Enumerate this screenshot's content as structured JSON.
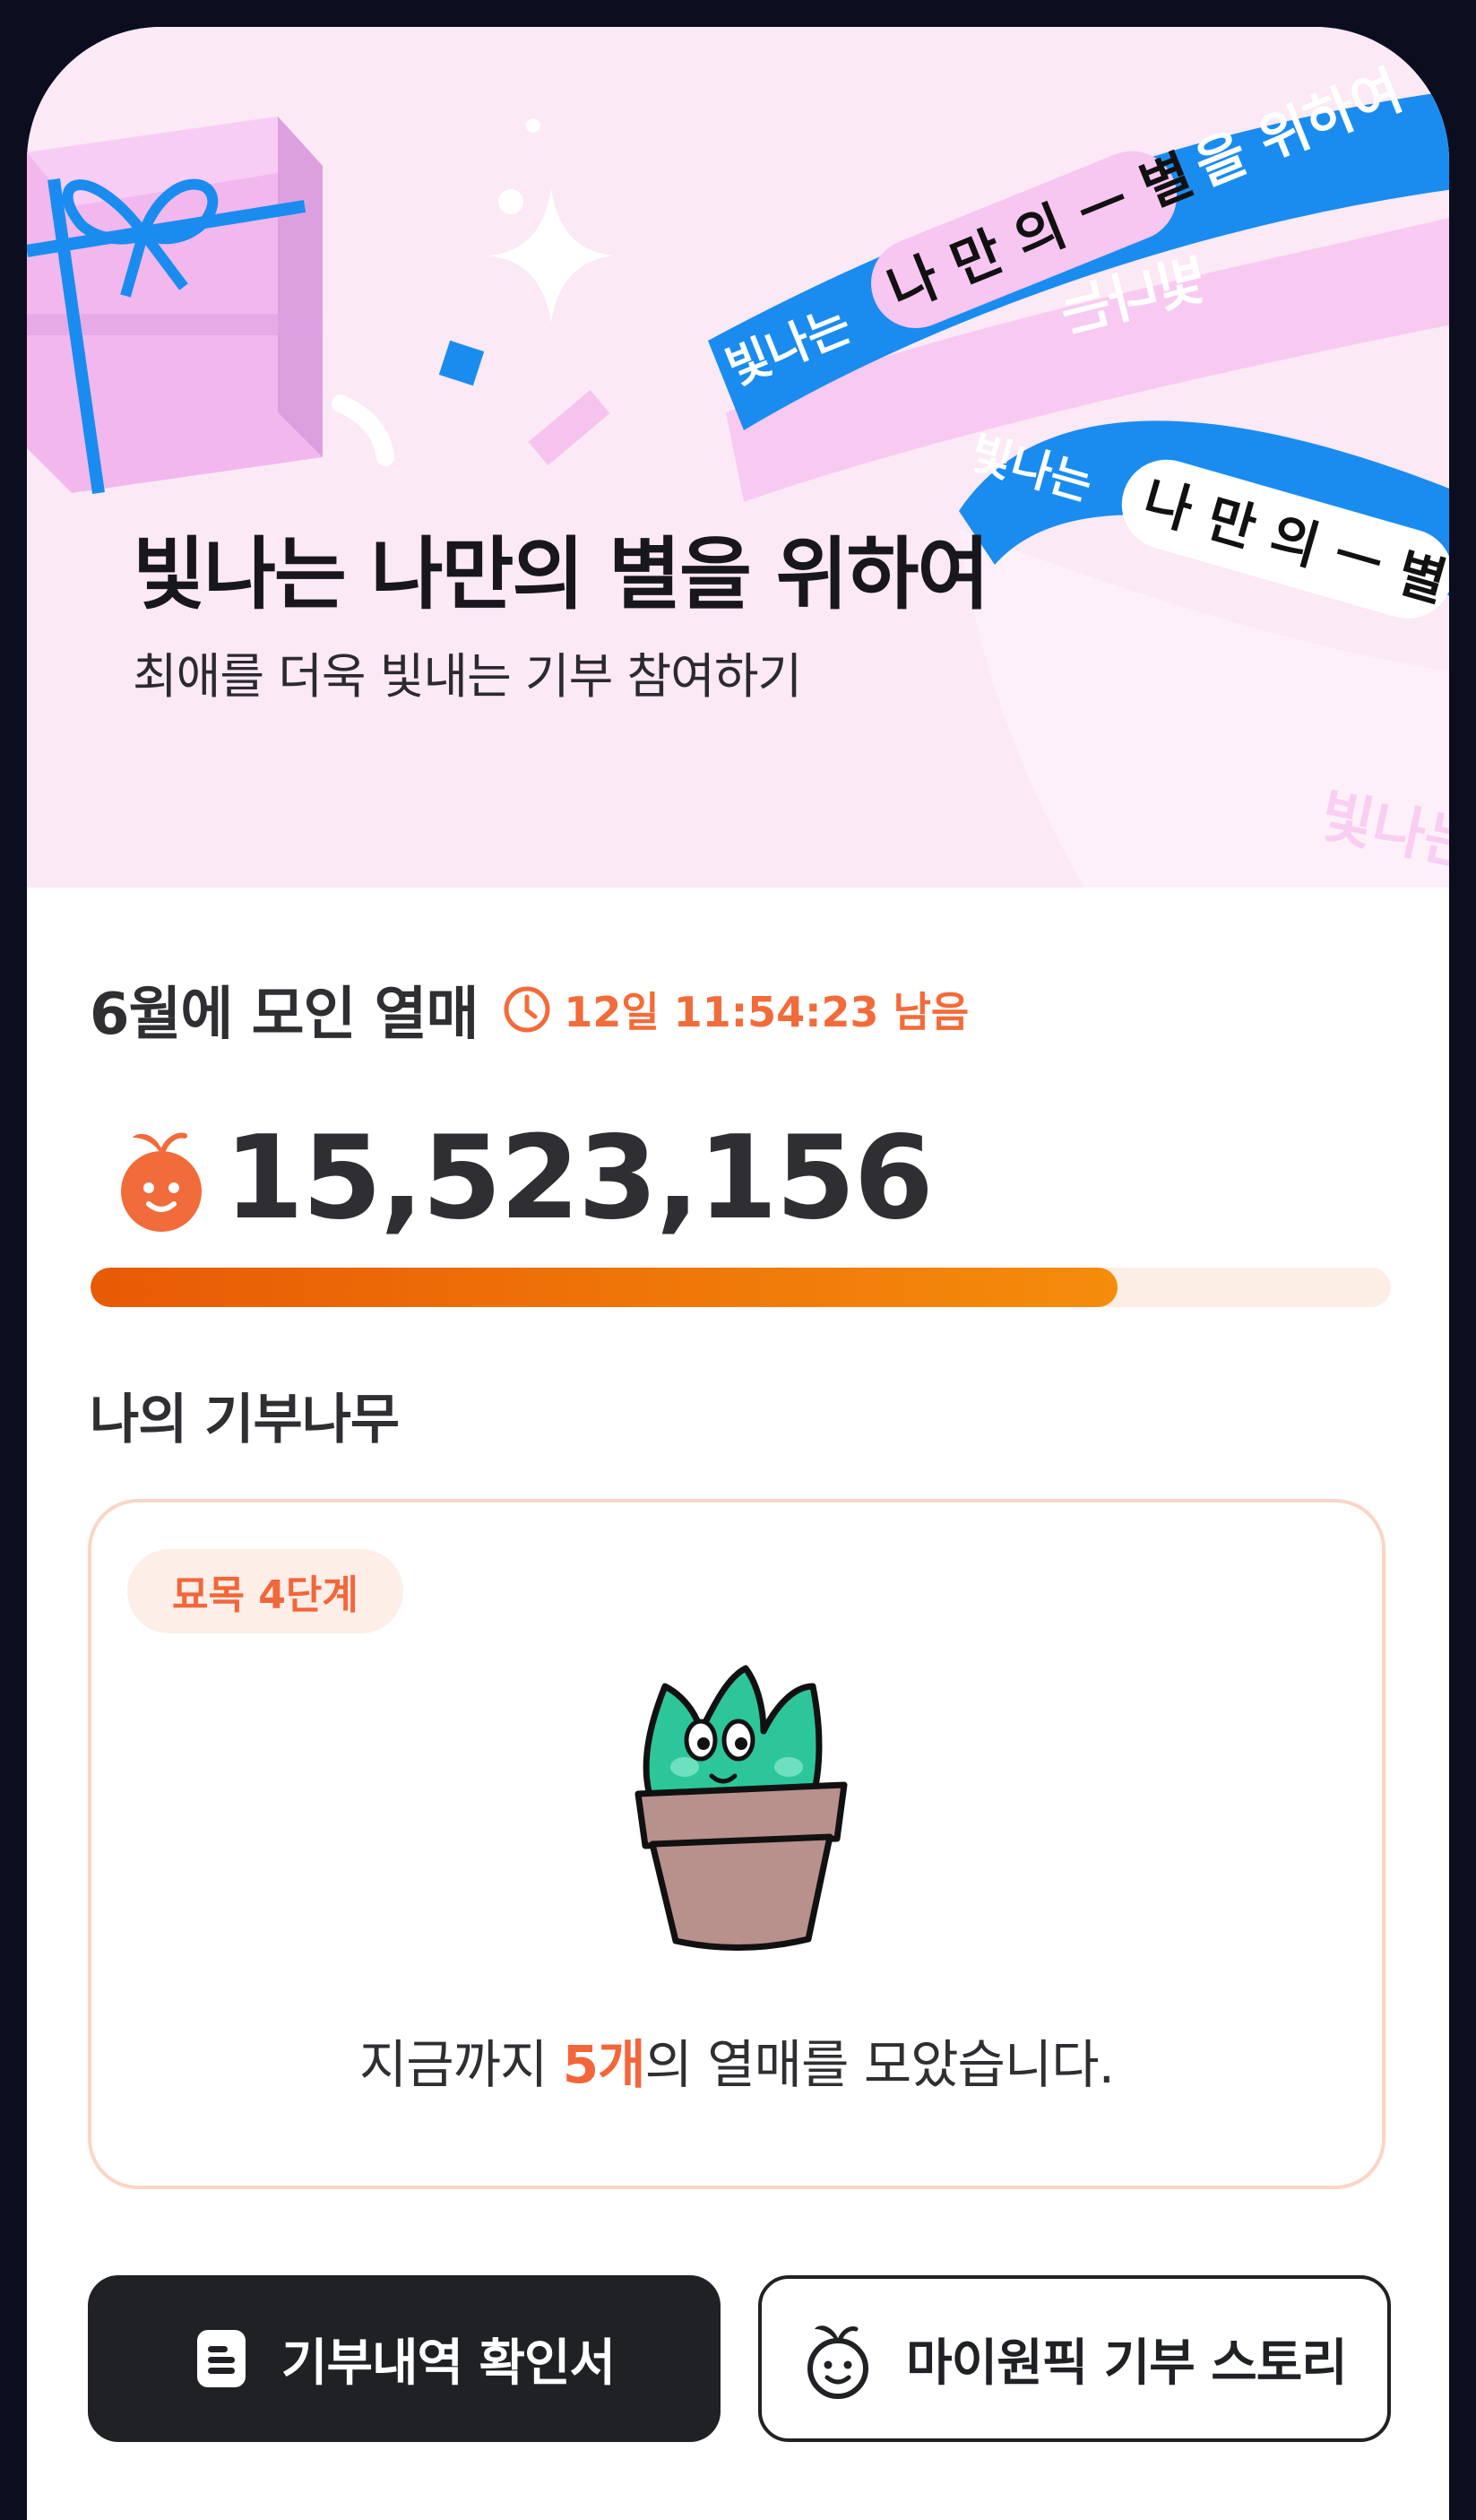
{
  "banner": {
    "title": "빛나는 나만의 별을 위하여",
    "subtitle": "최애를 더욱 빛내는 기부 참여하기",
    "ribbon1": "빛나는 나 만 의 ㅡ 별 을 위하여",
    "ribbon2": "빛나는 나 만 의 ㅡ 별"
  },
  "collected": {
    "title": "6월에 모인 열매",
    "timer": "12일 11:54:23 남음",
    "count": "15,523,156",
    "progress_percent": 79
  },
  "tree": {
    "title": "나의 기부나무",
    "badge": "묘목 4단계",
    "message_prefix": "지금까지 ",
    "message_highlight": "5개",
    "message_suffix": "의 열매를 모았습니다."
  },
  "buttons": {
    "receipt_label": "기부내역 확인서",
    "story_label": "마이원픽 기부 스토리"
  },
  "colors": {
    "accent": "#f26b3a",
    "banner_bg": "#fbe9f5",
    "ribbon_blue": "#1a8cf0",
    "dark_button": "#1f2125"
  }
}
